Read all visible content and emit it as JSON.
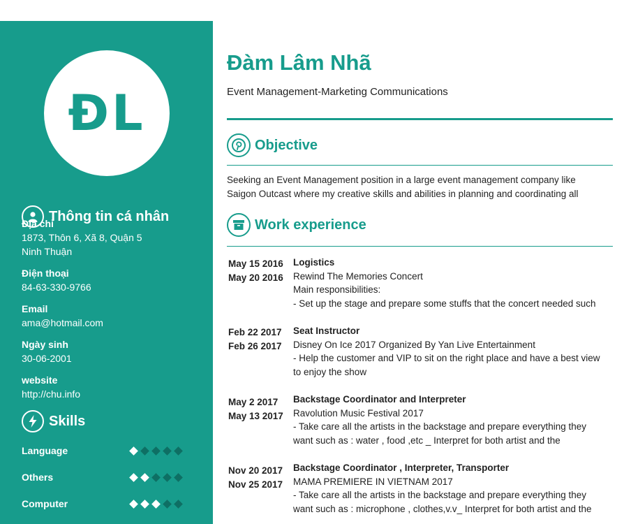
{
  "initials": "ĐL",
  "name": "Đàm Lâm Nhã",
  "title": "Event Management-Marketing Communications",
  "personal": {
    "heading": "Thông tin cá nhân",
    "address_label": "Địa chỉ",
    "address_line1": "1873, Thôn 6, Xã 8, Quận 5",
    "address_line2": "Ninh Thuận",
    "phone_label": "Điện thoại",
    "phone": "84-63-330-9766",
    "email_label": "Email",
    "email": "ama@hotmail.com",
    "birth_label": "Ngày sinh",
    "birth": "30-06-2001",
    "website_label": "website",
    "website": "http://chu.info"
  },
  "skills": {
    "heading": "Skills",
    "items": [
      {
        "name": "Language",
        "level": 1,
        "max": 5
      },
      {
        "name": "Others",
        "level": 2,
        "max": 5
      },
      {
        "name": "Computer",
        "level": 3,
        "max": 5
      }
    ]
  },
  "objective": {
    "heading": "Objective",
    "line1": "Seeking an Event Management position in a large event management company like",
    "line2": "Saigon Outcast where my creative skills and abilities in planning and coordinating all"
  },
  "work": {
    "heading": "Work experience",
    "jobs": [
      {
        "start": "May 15 2016",
        "end": "May 20 2016",
        "role": "Logistics",
        "company": "Rewind The Memories Concert",
        "line1": "Main responsibilities:",
        "line2": "- Set up the stage and prepare some stuffs that the concert needed such"
      },
      {
        "start": "Feb 22 2017",
        "end": "Feb 26 2017",
        "role": "Seat Instructor",
        "company": "Disney On Ice 2017 Organized By Yan Live Entertainment",
        "line1": "- Help the customer and VIP to sit on the right place and have a best view",
        "line2": "to enjoy the show"
      },
      {
        "start": "May 2 2017",
        "end": "May 13 2017",
        "role": "Backstage Coordinator and Interpreter",
        "company": "Ravolution Music Festival 2017",
        "line1": "- Take care all the artists in the backstage and prepare everything they",
        "line2": "want such as : water , food ,etc _ Interpret for both artist and the"
      },
      {
        "start": "Nov 20 2017",
        "end": "Nov 25 2017",
        "role": "Backstage Coordinator , Interpreter, Transporter",
        "company": "MAMA PREMIERE IN VIETNAM 2017",
        "line1": "- Take care all the artists in the backstage and prepare everything they",
        "line2": "want such as : microphone , clothes,v.v_ Interpret for both artist and the"
      }
    ]
  },
  "colors": {
    "accent": "#179c8c",
    "dot_off": "#0e6f64"
  }
}
